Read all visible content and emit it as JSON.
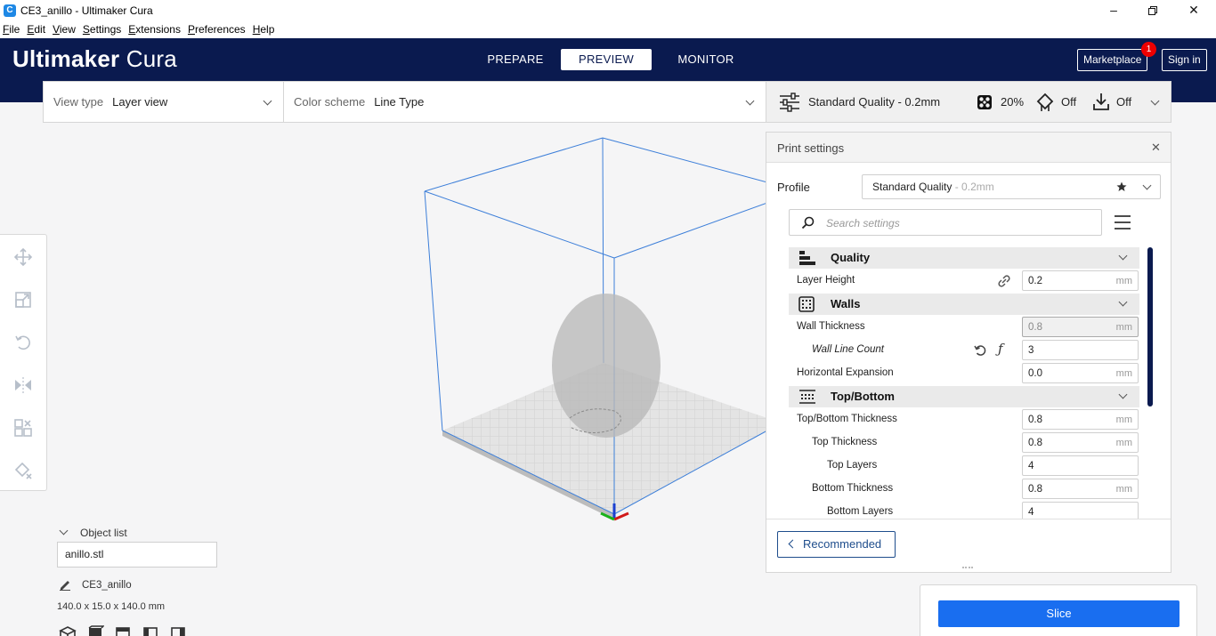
{
  "window": {
    "title": "CE3_anillo - Ultimaker Cura"
  },
  "menu": [
    "File",
    "Edit",
    "View",
    "Settings",
    "Extensions",
    "Preferences",
    "Help"
  ],
  "header": {
    "brand_bold": "Ultimaker",
    "brand_light": " Cura",
    "tabs": [
      "PREPARE",
      "PREVIEW",
      "MONITOR"
    ],
    "active_tab": "PREVIEW",
    "marketplace": "Marketplace",
    "marketplace_badge": "1",
    "signin": "Sign in"
  },
  "viewbar": {
    "view_type_label": "View type",
    "view_type_value": "Layer view",
    "color_scheme_label": "Color scheme",
    "color_scheme_value": "Line Type"
  },
  "quality_bar": {
    "profile": "Standard Quality - 0.2mm",
    "infill": "20%",
    "support": "Off",
    "adhesion": "Off"
  },
  "print_settings": {
    "title": "Print settings",
    "profile_label": "Profile",
    "profile_value": "Standard Quality",
    "profile_suffix": " - 0.2mm",
    "search_placeholder": "Search settings",
    "categories": {
      "quality": "Quality",
      "walls": "Walls",
      "topbottom": "Top/Bottom"
    },
    "settings": {
      "layer_height": {
        "label": "Layer Height",
        "value": "0.2",
        "unit": "mm"
      },
      "wall_thickness": {
        "label": "Wall Thickness",
        "value": "0.8",
        "unit": "mm"
      },
      "wall_line_count": {
        "label": "Wall Line Count",
        "value": "3"
      },
      "horizontal_expansion": {
        "label": "Horizontal Expansion",
        "value": "0.0",
        "unit": "mm"
      },
      "topbottom_thickness": {
        "label": "Top/Bottom Thickness",
        "value": "0.8",
        "unit": "mm"
      },
      "top_thickness": {
        "label": "Top Thickness",
        "value": "0.8",
        "unit": "mm"
      },
      "top_layers": {
        "label": "Top Layers",
        "value": "4"
      },
      "bottom_thickness": {
        "label": "Bottom Thickness",
        "value": "0.8",
        "unit": "mm"
      },
      "bottom_layers": {
        "label": "Bottom Layers",
        "value": "4"
      }
    },
    "recommended": "Recommended"
  },
  "object_list": {
    "label": "Object list",
    "file": "anillo.stl",
    "job_name": "CE3_anillo",
    "dimensions": "140.0 x 15.0 x 140.0 mm"
  },
  "slice": {
    "label": "Slice"
  },
  "colors": {
    "header_bg": "#0a1a4f",
    "accent": "#196ef0",
    "badge": "#ee0000"
  }
}
